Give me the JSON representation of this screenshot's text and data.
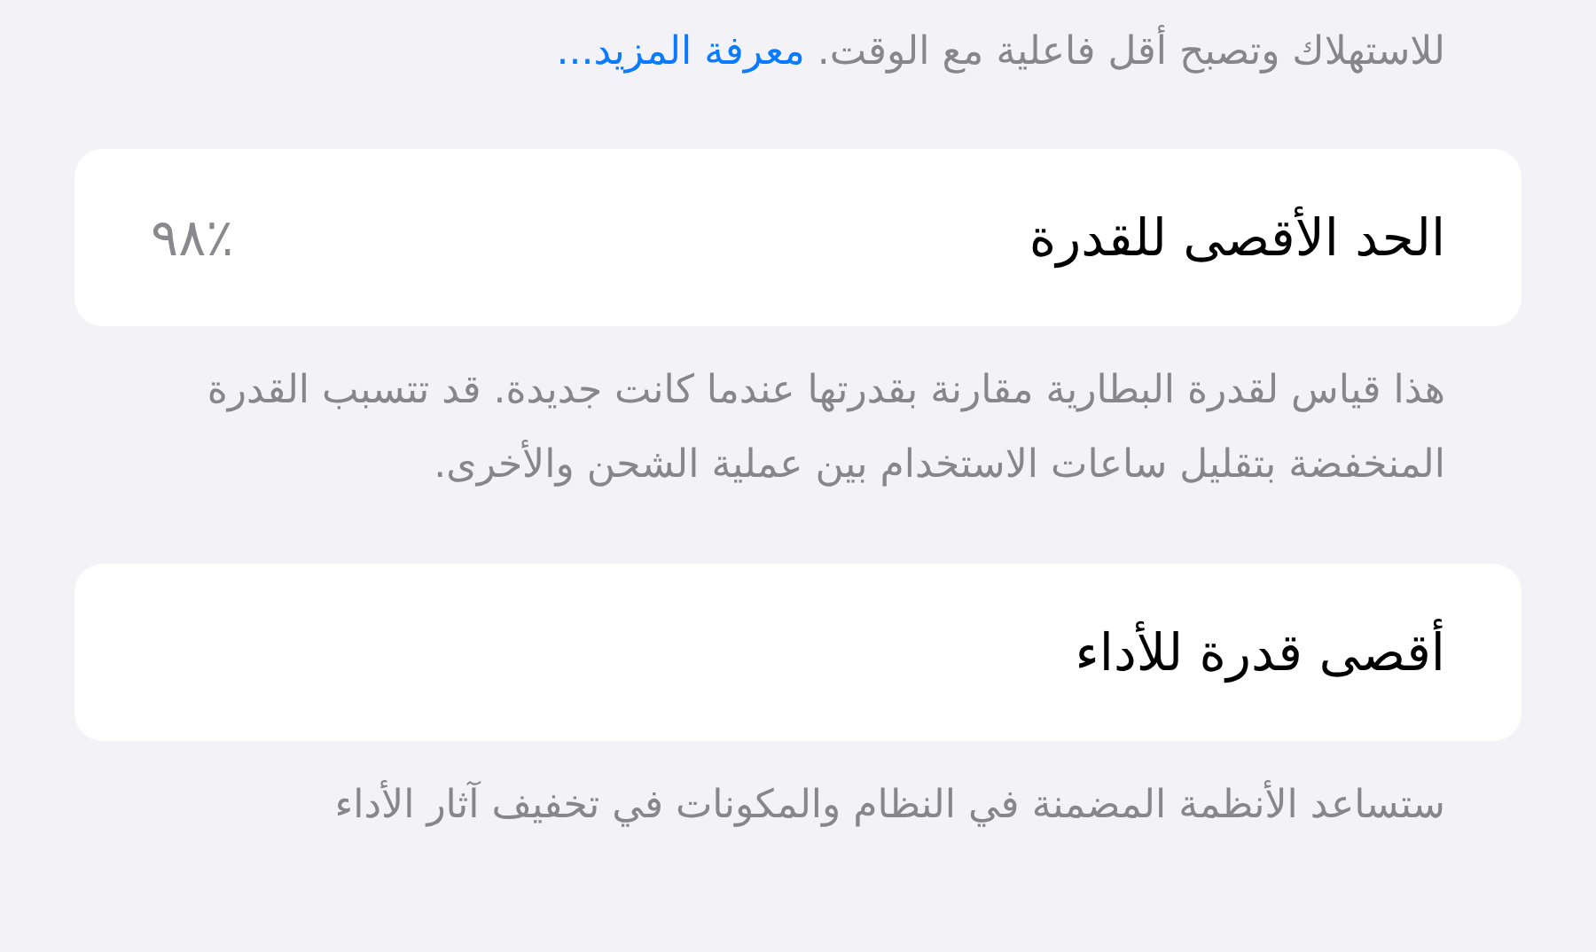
{
  "intro": {
    "text": "للاستهلاك وتصبح أقل فاعلية مع الوقت.",
    "link": "معرفة المزيد..."
  },
  "sections": [
    {
      "title": "الحد الأقصى للقدرة",
      "value": "٪٩٨",
      "footnote": "هذا قياس لقدرة البطارية مقارنة بقدرتها عندما كانت جديدة. قد تتسبب القدرة المنخفضة بتقليل ساعات الاستخدام بين عملية الشحن والأخرى."
    },
    {
      "title": "أقصى قدرة للأداء",
      "footnote": "ستساعد الأنظمة المضمنة في النظام والمكونات في تخفيف آثار الأداء"
    }
  ]
}
